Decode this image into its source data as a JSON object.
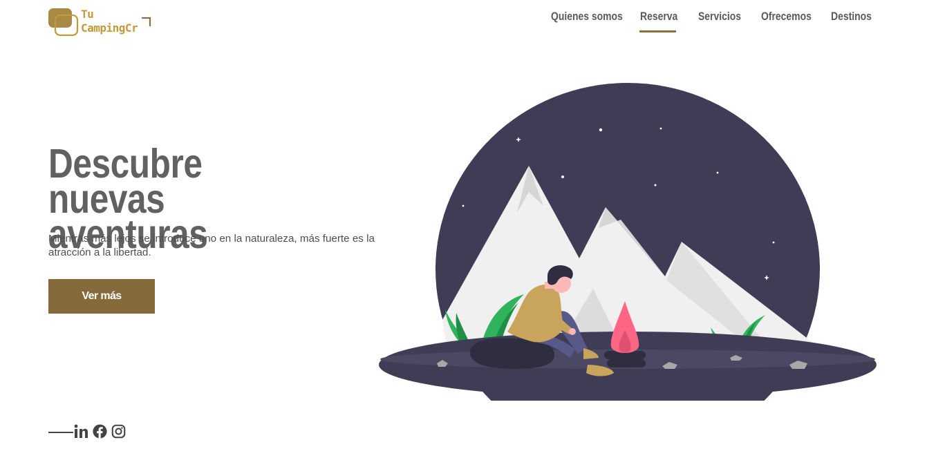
{
  "brand": {
    "line1": "Tu",
    "line2": "CampingCr",
    "color": "#c29a3b"
  },
  "nav": {
    "items": [
      {
        "label": "Quienes somos"
      },
      {
        "label": "Reserva",
        "active": true
      },
      {
        "label": "Servicios"
      },
      {
        "label": "Ofrecemos"
      },
      {
        "label": "Destinos"
      }
    ],
    "active_color": "#8a7040"
  },
  "hero": {
    "title_line1": "Descubre nuevas",
    "title_line2": "aventuras",
    "subtitle_line1": "Mientras más lejos se introduce uno en la naturaleza, más fuerte es la",
    "subtitle_line2": "atracción a la libertad.",
    "cta_label": "Ver más",
    "cta_color": "#856b3b"
  },
  "social": {
    "icons": [
      "linkedin-icon",
      "facebook-icon",
      "instagram-icon"
    ]
  },
  "illustration": {
    "name": "camping-night-scene",
    "sky_color": "#3f3d56",
    "fire_color": "#ff6584",
    "plant_color": "#2fb35c"
  }
}
